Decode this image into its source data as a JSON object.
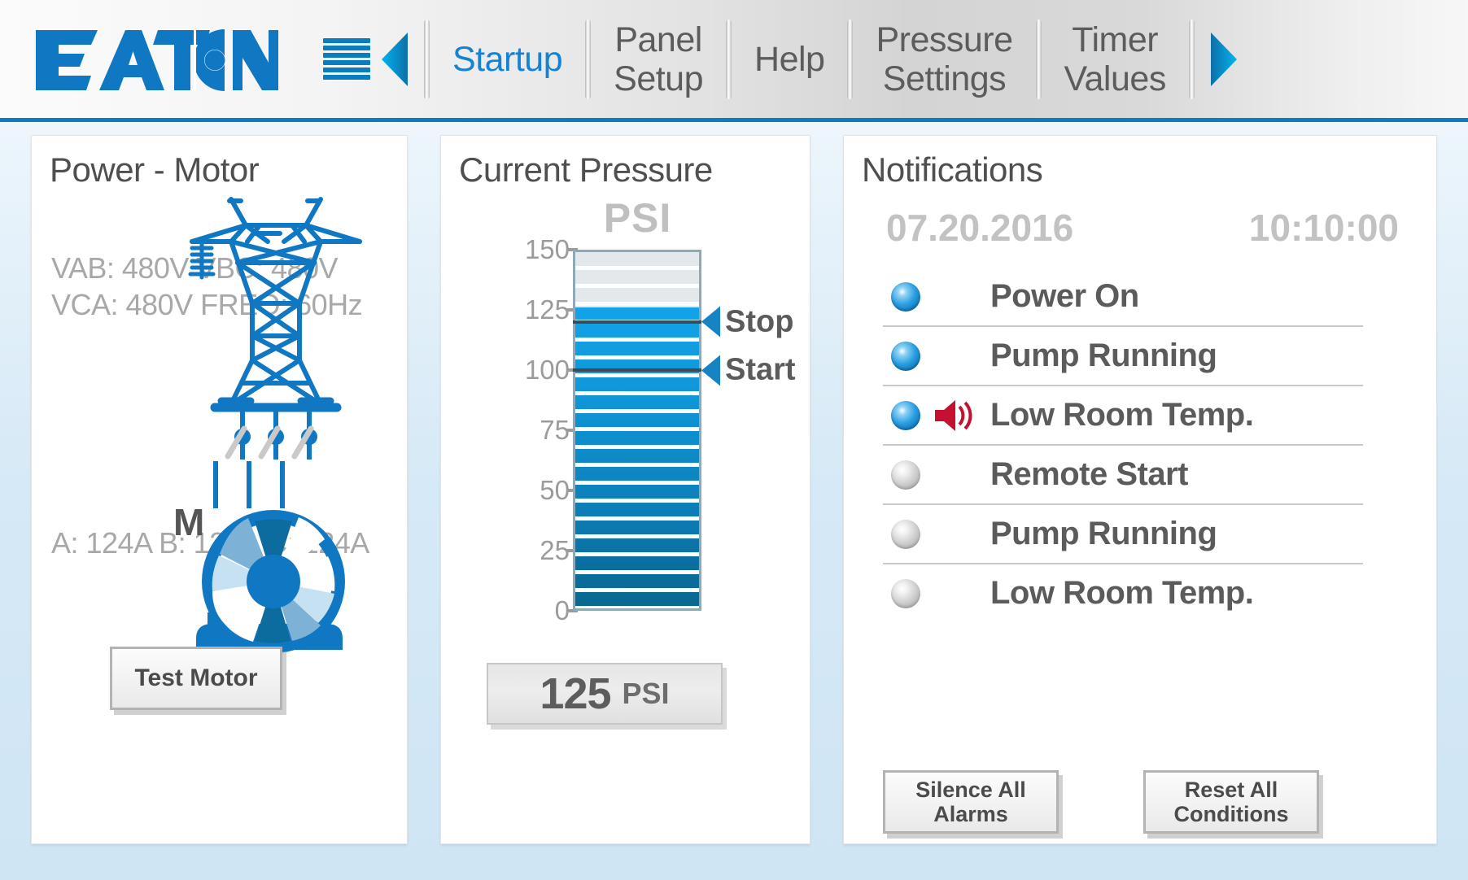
{
  "header": {
    "logo_text": "EATON",
    "menu_icon": "hamburger-icon",
    "prev_icon": "chevron-left-icon",
    "next_icon": "chevron-right-icon",
    "tabs": [
      {
        "label": "Startup",
        "active": true
      },
      {
        "label": "Panel\nSetup",
        "active": false
      },
      {
        "label": "Help",
        "active": false
      },
      {
        "label": "Pressure\nSettings",
        "active": false
      },
      {
        "label": "Timer\nValues",
        "active": false
      }
    ]
  },
  "power_card": {
    "title": "Power - Motor",
    "voltages": "VAB: 480V\nVBC: 480V\nVCA: 480V\nFREQ: 60Hz",
    "currents": "A: 124A\nB: 124A\nC: 124A",
    "motor_symbol": "M",
    "test_button": "Test Motor",
    "accent_color": "#0a7cc0"
  },
  "pressure_card": {
    "title": "Current Pressure",
    "unit_label": "PSI",
    "value": "125",
    "value_unit": "PSI",
    "stop_label": "Stop",
    "start_label": "Start",
    "chart_data": {
      "type": "bar",
      "title": "Current Pressure",
      "ylabel": "PSI",
      "categories": [
        "Current Pressure"
      ],
      "values": [
        125
      ],
      "ylim": [
        0,
        150
      ],
      "tick_labels": [
        "150",
        "125",
        "100",
        "75",
        "50",
        "25",
        "0"
      ],
      "tick_values": [
        150,
        125,
        100,
        75,
        50,
        25,
        0
      ],
      "grid": true,
      "legend": false,
      "annotations": [
        {
          "label": "Stop",
          "value": 120
        },
        {
          "label": "Start",
          "value": 100
        }
      ],
      "fill_color": "#0f96d8",
      "empty_color": "#e2e8ec"
    }
  },
  "notifications_card": {
    "title": "Notifications",
    "date": "07.20.2016",
    "time": "10:10:00",
    "rows": [
      {
        "label": "Power On",
        "led": "on",
        "alarm": false
      },
      {
        "label": "Pump Running",
        "led": "on",
        "alarm": false
      },
      {
        "label": "Low Room Temp.",
        "led": "on",
        "alarm": true
      },
      {
        "label": "Remote Start",
        "led": "off",
        "alarm": false
      },
      {
        "label": "Pump Running",
        "led": "off",
        "alarm": false
      },
      {
        "label": "Low Room Temp.",
        "led": "off",
        "alarm": false
      }
    ],
    "silence_button": "Silence  All\nAlarms",
    "reset_button": "Reset  All\nConditions",
    "alarm_color": "#c4112f"
  }
}
